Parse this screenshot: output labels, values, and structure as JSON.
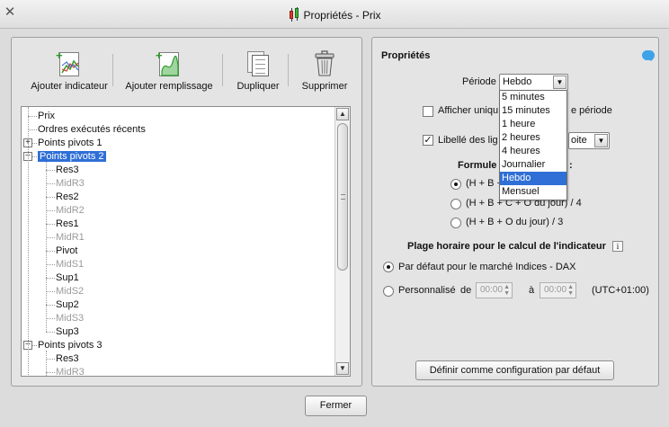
{
  "window": {
    "title": "Propriétés - Prix",
    "close_glyph": "✕"
  },
  "toolbar": [
    {
      "label": "Ajouter indicateur",
      "icon": "add-indicator-icon"
    },
    {
      "label": "Ajouter remplissage",
      "icon": "add-fill-icon"
    },
    {
      "label": "Dupliquer",
      "icon": "duplicate-icon"
    },
    {
      "label": "Supprimer",
      "icon": "trash-icon"
    }
  ],
  "tree": {
    "items": [
      {
        "label": "Prix",
        "level": 0,
        "toggle": "",
        "dim": false,
        "selected": false
      },
      {
        "label": "Ordres exécutés récents",
        "level": 0,
        "toggle": "",
        "dim": false,
        "selected": false
      },
      {
        "label": "Points pivots 1",
        "level": 0,
        "toggle": "+",
        "dim": false,
        "selected": false
      },
      {
        "label": "Points pivots 2",
        "level": 0,
        "toggle": "−",
        "dim": false,
        "selected": true
      },
      {
        "label": "Res3",
        "level": 1,
        "toggle": "",
        "dim": false,
        "selected": false
      },
      {
        "label": "MidR3",
        "level": 1,
        "toggle": "",
        "dim": true,
        "selected": false
      },
      {
        "label": "Res2",
        "level": 1,
        "toggle": "",
        "dim": false,
        "selected": false
      },
      {
        "label": "MidR2",
        "level": 1,
        "toggle": "",
        "dim": true,
        "selected": false
      },
      {
        "label": "Res1",
        "level": 1,
        "toggle": "",
        "dim": false,
        "selected": false
      },
      {
        "label": "MidR1",
        "level": 1,
        "toggle": "",
        "dim": true,
        "selected": false
      },
      {
        "label": "Pivot",
        "level": 1,
        "toggle": "",
        "dim": false,
        "selected": false
      },
      {
        "label": "MidS1",
        "level": 1,
        "toggle": "",
        "dim": true,
        "selected": false
      },
      {
        "label": "Sup1",
        "level": 1,
        "toggle": "",
        "dim": false,
        "selected": false
      },
      {
        "label": "MidS2",
        "level": 1,
        "toggle": "",
        "dim": true,
        "selected": false
      },
      {
        "label": "Sup2",
        "level": 1,
        "toggle": "",
        "dim": false,
        "selected": false
      },
      {
        "label": "MidS3",
        "level": 1,
        "toggle": "",
        "dim": true,
        "selected": false
      },
      {
        "label": "Sup3",
        "level": 1,
        "toggle": "",
        "dim": false,
        "selected": false
      },
      {
        "label": "Points pivots 3",
        "level": 0,
        "toggle": "−",
        "dim": false,
        "selected": false
      },
      {
        "label": "Res3",
        "level": 1,
        "toggle": "",
        "dim": false,
        "selected": false
      },
      {
        "label": "MidR3",
        "level": 1,
        "toggle": "",
        "dim": true,
        "selected": false
      }
    ]
  },
  "properties": {
    "title": "Propriétés",
    "periode_label": "Période",
    "periode_value": "Hebdo",
    "periode_options": [
      "5 minutes",
      "15 minutes",
      "1 heure",
      "2 heures",
      "4 heures",
      "Journalier",
      "Hebdo",
      "Mensuel"
    ],
    "periode_selected_index": 6,
    "afficher_label_left": "Afficher uniqu",
    "afficher_label_right": "e période",
    "libelle_label": "Libellé des lig",
    "libelle_value": "oite",
    "formule_label_left": "Formule",
    "formule_label_right": ":",
    "formula_options": [
      {
        "label": "(H + B +",
        "checked": true
      },
      {
        "label": "(H + B + C + O du jour) / 4",
        "checked": false
      },
      {
        "label": "(H + B + O du jour) / 3",
        "checked": false
      }
    ],
    "plage_label": "Plage horaire pour le calcul de l'indicateur",
    "info_glyph": "i",
    "range_default_label": "Par défaut pour le marché Indices - DAX",
    "range_custom_label": "Personnalisé",
    "de_label": "de",
    "a_label": "à",
    "time_from": "00:00",
    "time_to": "00:00",
    "timezone": "(UTC+01:00)",
    "default_button": "Définir comme configuration par défaut"
  },
  "footer": {
    "close_button": "Fermer"
  },
  "colors": {
    "selection": "#2f6fd6",
    "accent_green": "#2e9a2e",
    "chart_red": "#e23b2c"
  }
}
